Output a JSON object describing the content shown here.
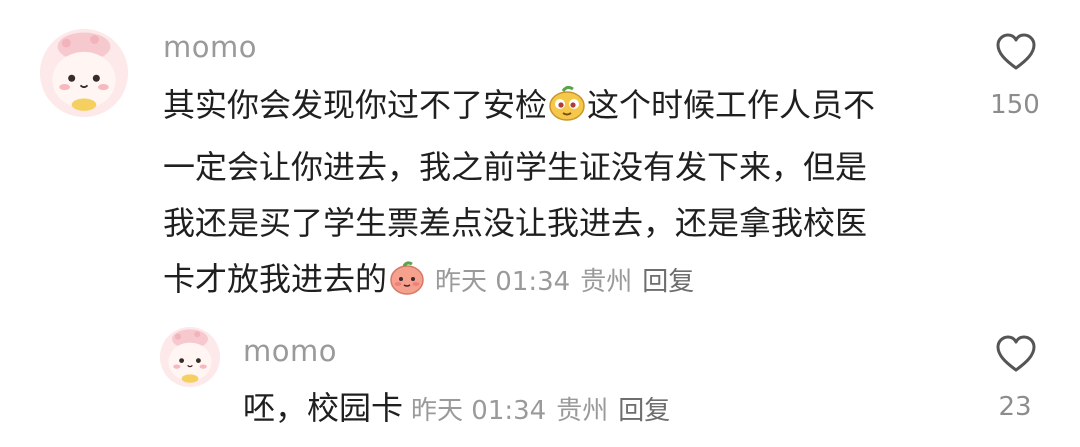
{
  "comment": {
    "username": "momo",
    "lines": [
      "其实你会发现你过不了安检",
      "这个时候工作人员不",
      "一定会让你进去，我之前学生证没有发下来，但是",
      "我还是买了学生票差点没让我进去，还是拿我校医",
      "卡才放我进去的"
    ],
    "emoji_1": "yellow-face-emoji",
    "emoji_2": "pink-peach-emoji",
    "time": "昨天 01:34",
    "location": "贵州",
    "reply_label": "回复",
    "like_icon": "heart-outline-icon",
    "like_count": "150"
  },
  "reply": {
    "username": "momo",
    "text": "呸，校园卡",
    "time": "昨天 01:34",
    "location": "贵州",
    "reply_label": "回复",
    "like_icon": "heart-outline-icon",
    "like_count": "23"
  },
  "colors": {
    "text": "#1f1f1f",
    "meta": "#9a9a9a",
    "icon": "#555555",
    "avatar_bg": "#fde9ea"
  }
}
